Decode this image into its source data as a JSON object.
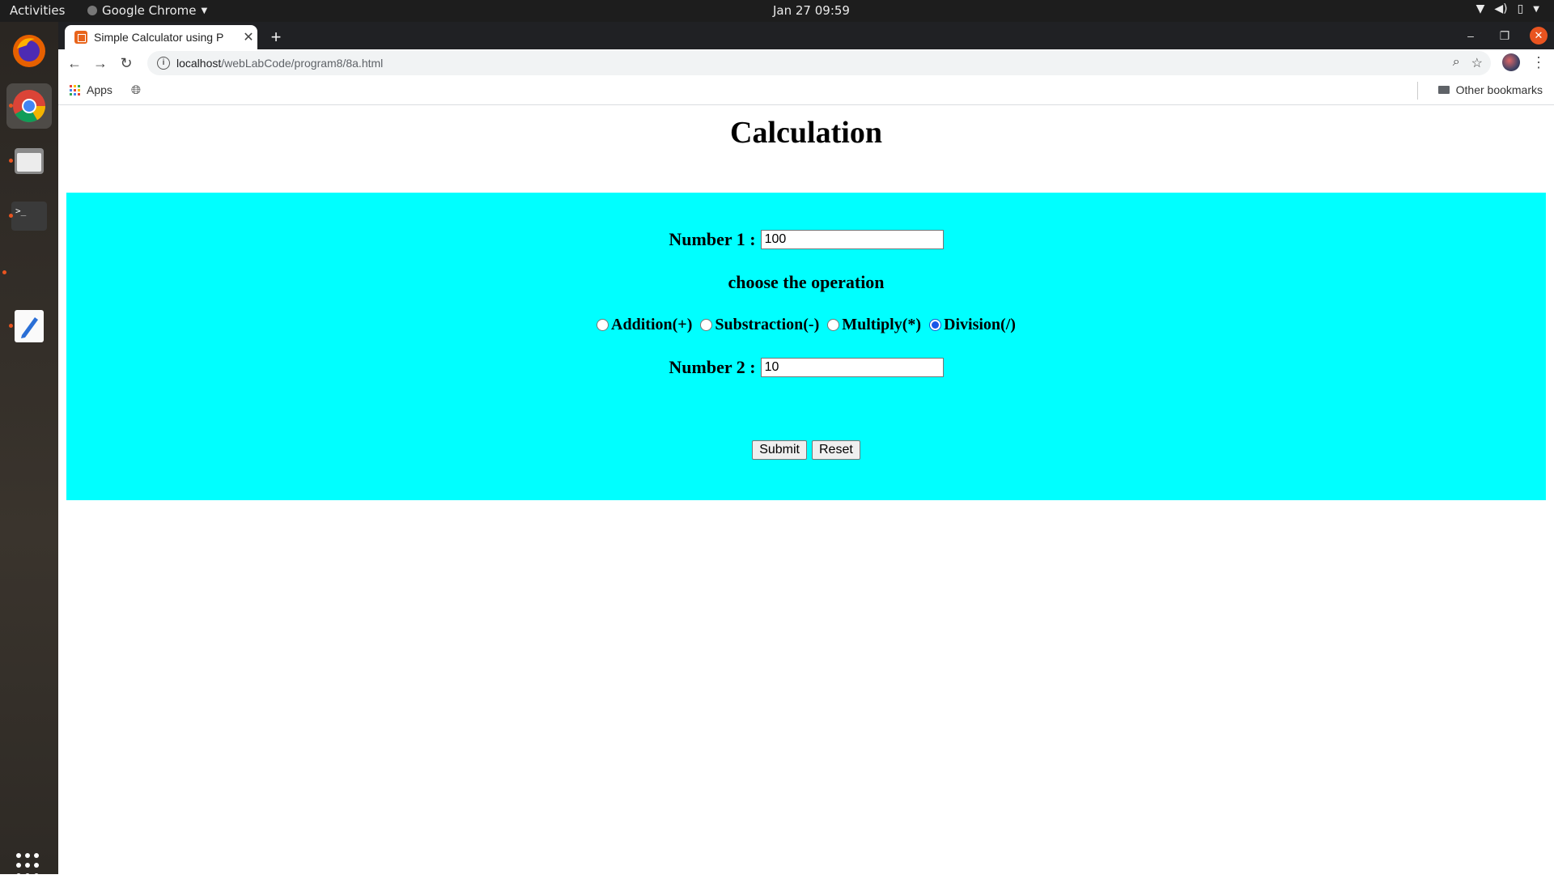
{
  "system": {
    "activities": "Activities",
    "app_name": "Google Chrome",
    "clock": "Jan 27  09:59"
  },
  "browser": {
    "tab_title": "Simple Calculator using P",
    "url_host": "localhost",
    "url_path": "/webLabCode/program8/8a.html",
    "bookmarks": {
      "apps_label": "Apps",
      "other_label": "Other bookmarks"
    }
  },
  "page": {
    "heading": "Calculation",
    "number1_label": "Number 1 :",
    "number1_value": "100",
    "operation_heading": "choose the operation",
    "operations": [
      {
        "label": "Addition(+)",
        "checked": false
      },
      {
        "label": "Substraction(-)",
        "checked": false
      },
      {
        "label": "Multiply(*)",
        "checked": false
      },
      {
        "label": "Division(/)",
        "checked": true
      }
    ],
    "number2_label": "Number 2 :",
    "number2_value": "10",
    "submit_label": "Submit",
    "reset_label": "Reset",
    "panel_color": "#00ffff"
  },
  "icons": [
    "firefox-icon",
    "chrome-icon",
    "files-icon",
    "terminal-icon",
    "text-editor-icon",
    "show-apps-icon"
  ]
}
